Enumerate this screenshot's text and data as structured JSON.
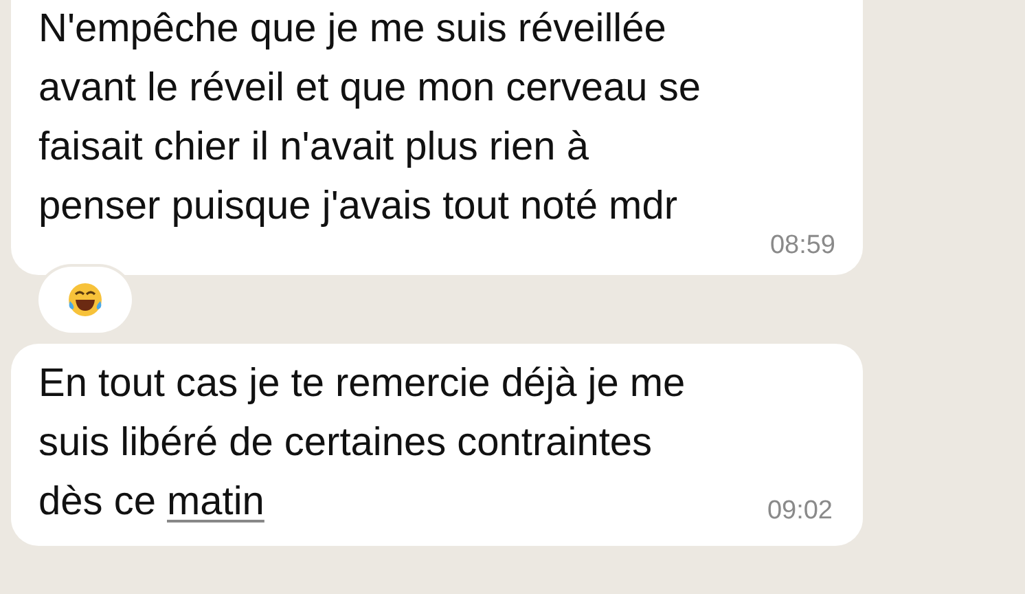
{
  "messages": [
    {
      "segments": [
        {
          "kind": "plain",
          "text": "N'empêche que je me suis réveillée\navant le réveil et que mon cerveau se\nfaisait chier il n'avait plus rien à\npenser puisque j'avais tout noté mdr"
        }
      ],
      "time": "08:59",
      "reacted": true,
      "cut_top": true
    },
    {
      "segments": [
        {
          "kind": "plain",
          "text": "En tout cas je te remercie déjà je me\nsuis libéré de certaines contraintes\ndès ce "
        },
        {
          "kind": "link",
          "text": "matin"
        }
      ],
      "time": "09:02",
      "reacted": false,
      "cut_top": false
    }
  ]
}
